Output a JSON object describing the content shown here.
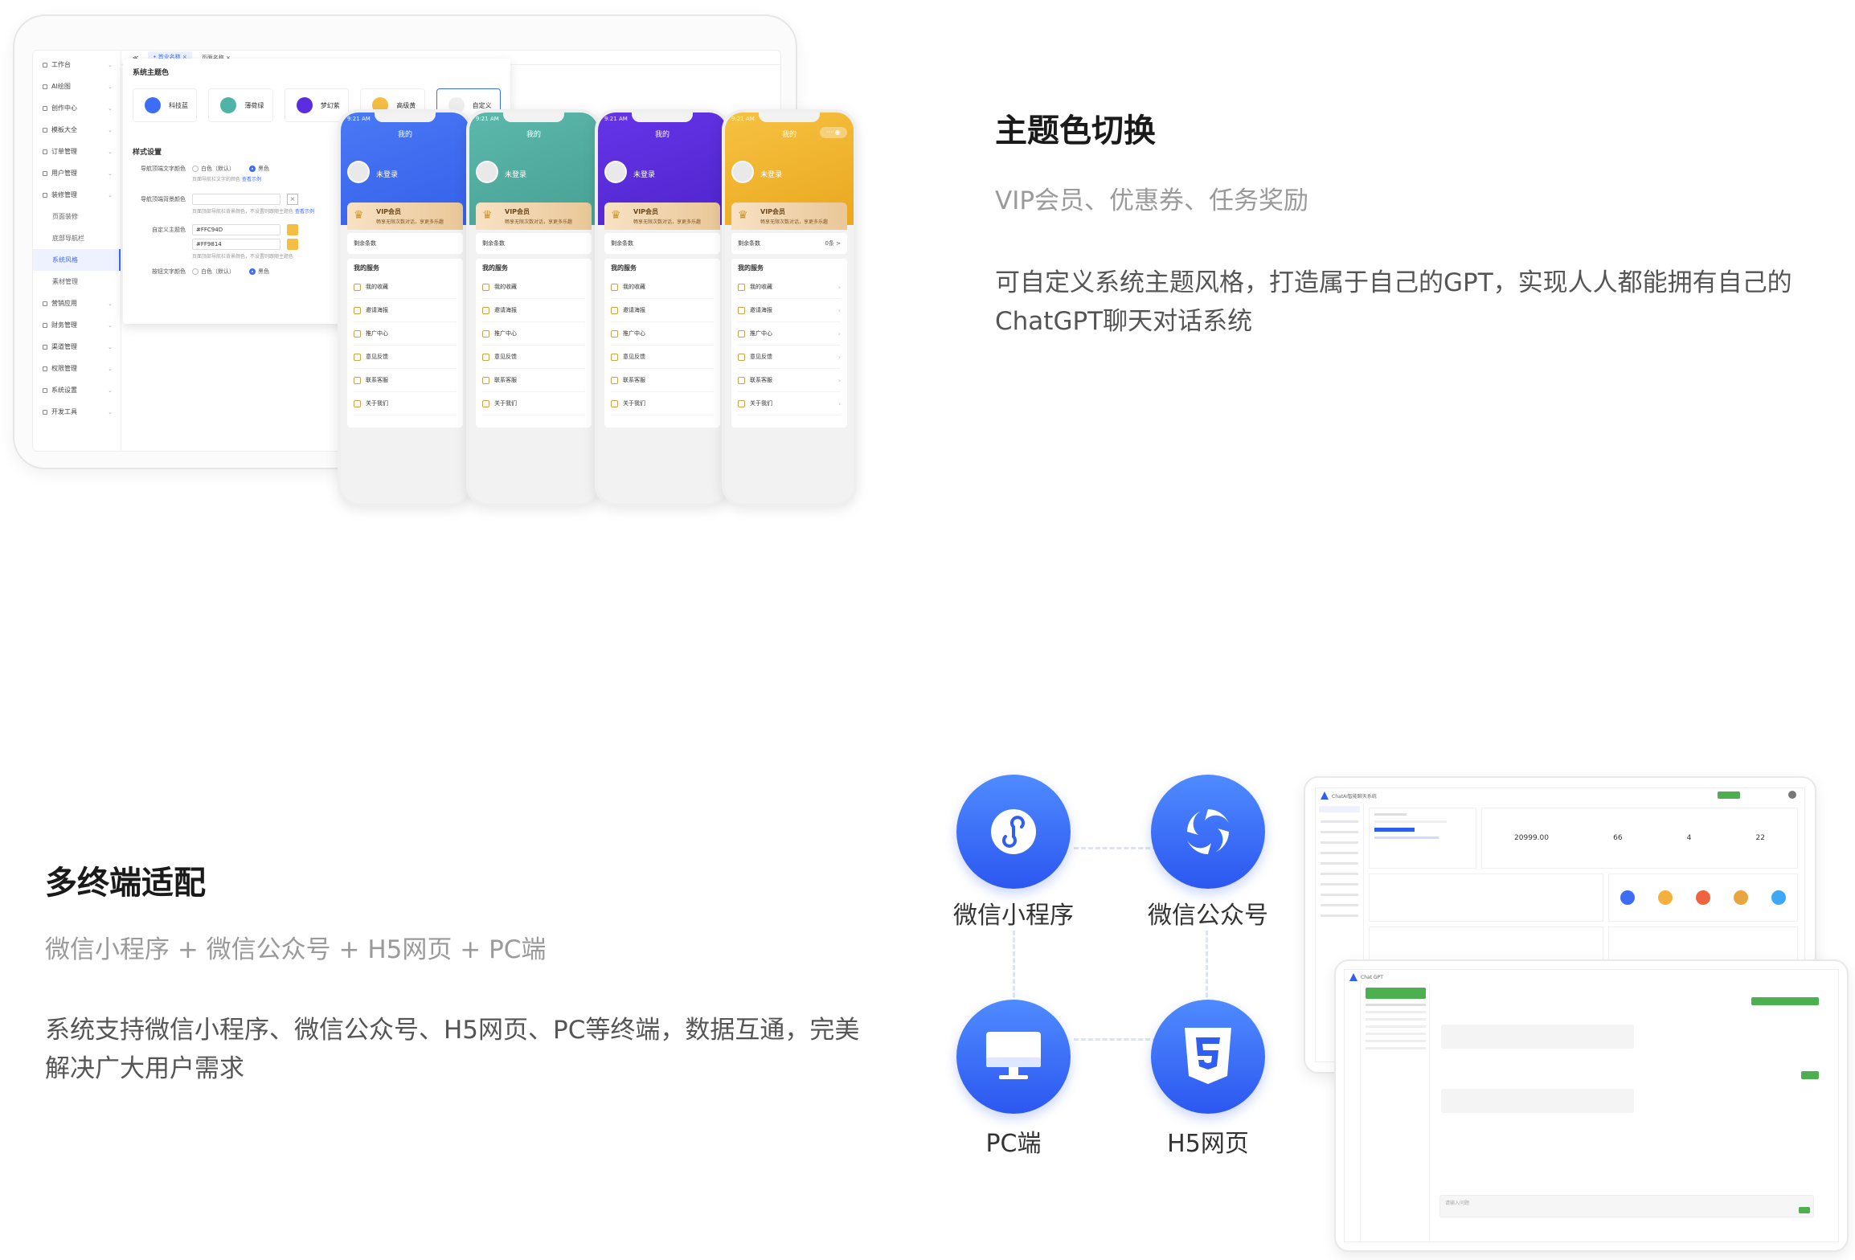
{
  "section1": {
    "title": "主题色切换",
    "subtitle": "VIP会员、优惠券、任务奖励",
    "body": "可自定义系统主题风格，打造属于自己的GPT，实现人人都能拥有自己的ChatGPT聊天对话系统"
  },
  "admin": {
    "tabs": [
      "≪",
      "• 首业名称 ×",
      "页面名称 ×"
    ],
    "sidebar": [
      {
        "label": "工作台",
        "sub": false,
        "active": false
      },
      {
        "label": "AI绘图",
        "sub": false,
        "active": false
      },
      {
        "label": "创作中心",
        "sub": false,
        "active": false
      },
      {
        "label": "模板大全",
        "sub": false,
        "active": false
      },
      {
        "label": "订单管理",
        "sub": false,
        "active": false
      },
      {
        "label": "用户管理",
        "sub": false,
        "active": false
      },
      {
        "label": "装修管理",
        "sub": false,
        "active": false
      },
      {
        "label": "页面装修",
        "sub": true,
        "active": false
      },
      {
        "label": "底部导航栏",
        "sub": true,
        "active": false
      },
      {
        "label": "系统风格",
        "sub": true,
        "active": true
      },
      {
        "label": "素材管理",
        "sub": true,
        "active": false
      },
      {
        "label": "营销应用",
        "sub": false,
        "active": false
      },
      {
        "label": "财务管理",
        "sub": false,
        "active": false
      },
      {
        "label": "渠道管理",
        "sub": false,
        "active": false
      },
      {
        "label": "权限管理",
        "sub": false,
        "active": false
      },
      {
        "label": "系统设置",
        "sub": false,
        "active": false
      },
      {
        "label": "开发工具",
        "sub": false,
        "active": false
      }
    ],
    "panel": {
      "theme_title": "系统主题色",
      "swatches": [
        {
          "label": "科技蓝",
          "color": "#3d6cf5"
        },
        {
          "label": "薄荷绿",
          "color": "#4fb3a7"
        },
        {
          "label": "梦幻紫",
          "color": "#5b2de0"
        },
        {
          "label": "高级黄",
          "color": "#f5bd42"
        },
        {
          "label": "自定义",
          "color": "#eeeeee"
        }
      ],
      "style_title": "样式设置",
      "nav_text_label": "导航顶端文字颜色",
      "nav_text_opt1": "白色（默认）",
      "nav_text_opt2": "黑色",
      "nav_text_hint": "页面导航栏文字的颜色",
      "nav_text_link": "查看示例",
      "nav_bg_label": "导航顶端背景颜色",
      "nav_bg_hint": "页面顶部导航栏背景颜色，不设置则跟随主题色",
      "nav_bg_link": "查看示例",
      "custom_color_label": "自定义主题色",
      "custom_color1": "#FFC94D",
      "custom_color2": "#FF9814",
      "custom_color_hint": "页面顶部导航栏背景颜色，不设置则跟随主题色",
      "btn_text_label": "按钮文字颜色",
      "btn_text_opt1": "白色（默认）",
      "btn_text_opt2": "黑色"
    }
  },
  "phones": [
    {
      "time": "9:21 AM",
      "title": "我的",
      "bg": "#4a79f5",
      "bg2": "#3560ea"
    },
    {
      "time": "9:21 AM",
      "title": "我的",
      "bg": "#5db8ac",
      "bg2": "#46a194"
    },
    {
      "time": "9:21 AM",
      "title": "我的",
      "bg": "#6535e8",
      "bg2": "#4f24cc"
    },
    {
      "time": "9:21 AM",
      "title": "我的",
      "bg": "#f6c242",
      "bg2": "#eaa71e"
    }
  ],
  "phone_common": {
    "uname": "未登录",
    "vip_title": "VIP会员",
    "vip_sub": "畅享无限次数对话，享更多乐趣",
    "remain_label": "剩余条数",
    "remain_value": "0条 >",
    "services_title": "我的服务",
    "menu": [
      "我的收藏",
      "邀请海报",
      "推广中心",
      "意见反馈",
      "联系客服",
      "关于我们"
    ]
  },
  "section2": {
    "title": "多终端适配",
    "subtitle": "微信小程序 + 微信公众号 + H5网页 + PC端",
    "body": "系统支持微信小程序、微信公众号、H5网页、PC等终端，数据互通，完美解决广大用户需求"
  },
  "terminals": [
    {
      "label": "微信小程序",
      "icon": "mini-program-icon"
    },
    {
      "label": "微信公众号",
      "icon": "official-account-icon"
    },
    {
      "label": "PC端",
      "icon": "monitor-icon"
    },
    {
      "label": "H5网页",
      "icon": "html5-icon"
    }
  ],
  "pc_admin": {
    "brand": "ChatAI智能聊天系统",
    "stats": [
      "20999.00",
      "66",
      "4",
      "22"
    ]
  },
  "pc_chat": {
    "brand": "Chat GPT",
    "input_placeholder": "请输入问题"
  }
}
